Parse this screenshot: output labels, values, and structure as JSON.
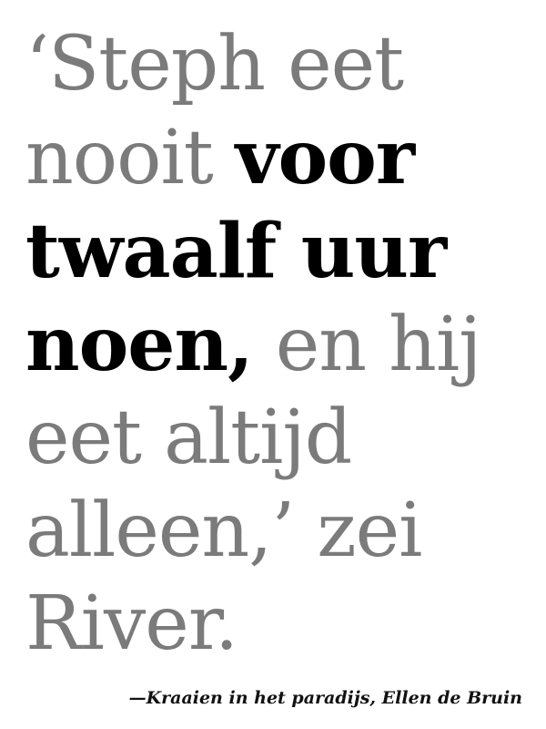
{
  "quote": {
    "line1": "‘Steph eet",
    "line2_plain": "nooit ",
    "line2_bold": "voor",
    "line3_bold": "twaalf uur",
    "line4_bold": "noen,",
    "line4_plain": " en hij",
    "line5": "eet altijd",
    "line6": "alleen,’ zei",
    "line7": "River."
  },
  "attribution": "—Kraaien in het paradijs, Ellen de Bruin",
  "colors": {
    "muted_text": "#7b7b7b",
    "highlight_text": "#000000",
    "background": "#ffffff"
  }
}
